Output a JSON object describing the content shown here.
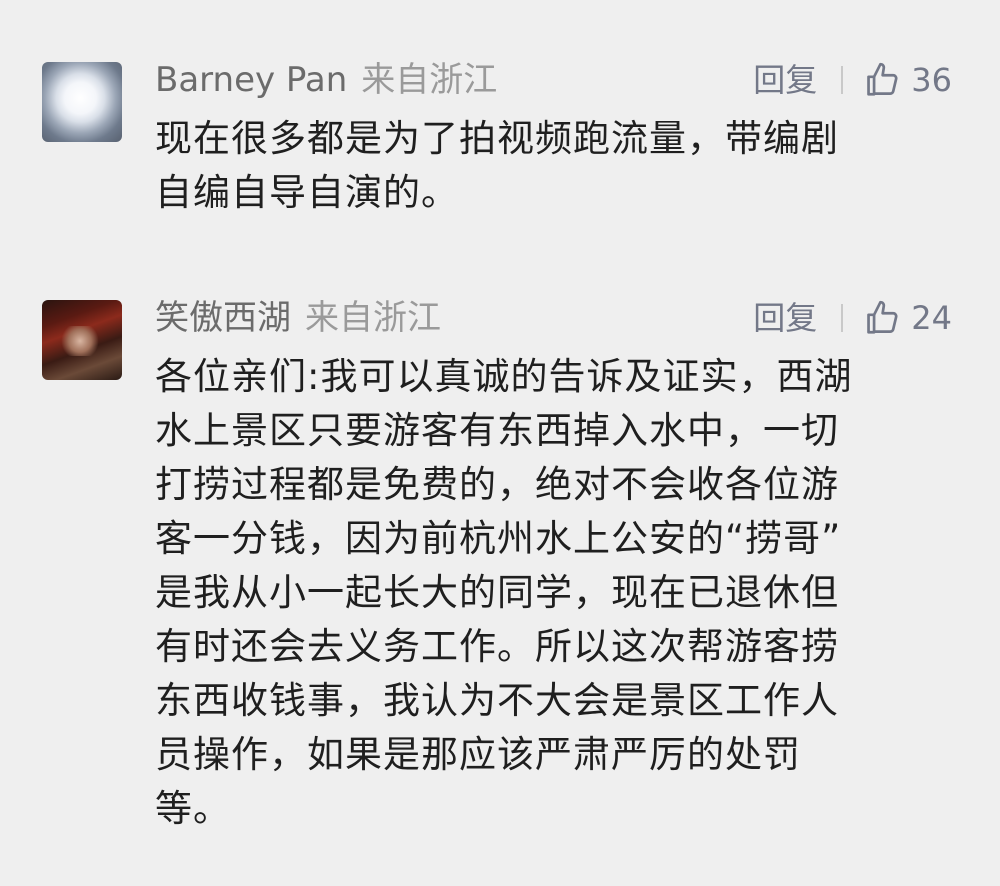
{
  "comments": [
    {
      "author": "Barney Pan",
      "location": "来自浙江",
      "reply_label": "回复",
      "like_count": "36",
      "text_lines": [
        "现在很多都是为了拍视频跑流量，带编剧",
        "自编自导自演的。"
      ]
    },
    {
      "author": "笑傲西湖",
      "location": "来自浙江",
      "reply_label": "回复",
      "like_count": "24",
      "text_lines": [
        "各位亲们:我可以真诚的告诉及证实，西湖",
        "水上景区只要游客有东西掉入水中，一切",
        "打捞过程都是免费的，绝对不会收各位游",
        "客一分钱，因为前杭州水上公安的“捞哥”",
        "是我从小一起长大的同学，现在已退休但",
        "有时还会去义务工作。所以这次帮游客捞",
        "东西收钱事，我认为不大会是景区工作人",
        "员操作，如果是那应该严肃严厉的处罚",
        "等。"
      ]
    }
  ],
  "icons": {
    "like": "thumbs-up-outline-icon"
  },
  "colors": {
    "background": "#efefef",
    "author": "#6b6b6b",
    "location": "#9a9a9a",
    "action": "#737888",
    "body_text": "#1f1f1f"
  }
}
